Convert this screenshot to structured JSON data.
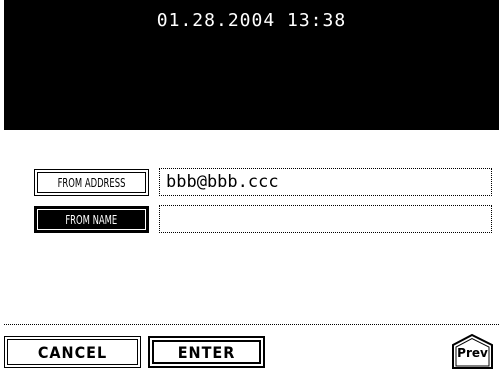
{
  "status": {
    "datetime": "01.28.2004 13:38"
  },
  "form": {
    "from_address": {
      "button_label": "FROM ADDRESS",
      "value": "bbb@bbb.ccc"
    },
    "from_name": {
      "button_label": "FROM NAME",
      "value": ""
    }
  },
  "footer": {
    "cancel_label": "CANCEL",
    "enter_label": "ENTER",
    "prev_label": "Prev",
    "prev_icon": "page-up-tab-icon"
  }
}
